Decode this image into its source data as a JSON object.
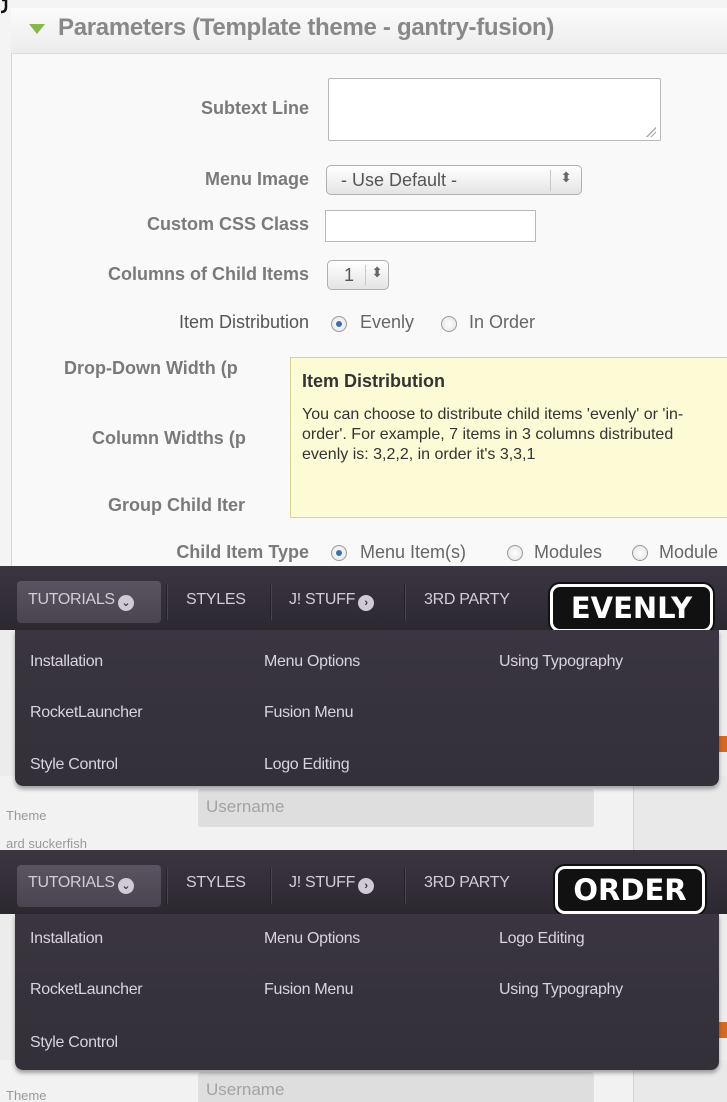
{
  "params": {
    "title": "Parameters (Template theme - gantry-fusion)",
    "subtext_label": "Subtext Line",
    "menu_image_label": "Menu Image",
    "menu_image_value": "- Use Default -",
    "css_class_label": "Custom CSS Class",
    "columns_label": "Columns of Child Items",
    "columns_value": "1",
    "distribution_label": "Item Distribution",
    "distribution_options": [
      "Evenly",
      "In Order"
    ],
    "distribution_selected": "Evenly",
    "dropdown_width_label": "Drop-Down Width (p",
    "column_widths_label": "Column Widths (p",
    "group_child_label": "Group Child Iter",
    "child_type_label": "Child Item Type",
    "child_type_options": [
      "Menu Item(s)",
      "Modules",
      "Module"
    ],
    "child_type_selected": "Menu Item(s)"
  },
  "tooltip": {
    "title": "Item Distribution",
    "body": "You can choose to distribute child items 'evenly' or 'in-order'. For example, 7 items in 3 columns distributed evenly is: 3,2,2, in order it's 3,3,1"
  },
  "nav": {
    "items": [
      "TUTORIALS",
      "STYLES",
      "J! STUFF",
      "3RD PARTY"
    ]
  },
  "evenly": {
    "badge": "EVENLY",
    "col1": [
      "Installation",
      "RocketLauncher",
      "Style Control"
    ],
    "col2": [
      "Menu Options",
      "Fusion Menu",
      "Logo Editing"
    ],
    "col3": [
      "Using Typography"
    ]
  },
  "order": {
    "badge": "ORDER",
    "col1": [
      "Installation",
      "RocketLauncher",
      "Style Control"
    ],
    "col2": [
      "Menu Options",
      "Fusion Menu"
    ],
    "col3": [
      "Logo Editing",
      "Using Typography"
    ]
  },
  "page": {
    "sidebar_texts": [
      "Theme",
      "ard suckerfish"
    ],
    "sidebar_text_bottom": "Theme",
    "username_placeholder": "Username"
  },
  "colors": {
    "accent_green": "#86b84a",
    "tooltip_bg": "#fdfbd6",
    "menu_bg": "#35303a",
    "radio_blue": "#3a6fb3"
  }
}
